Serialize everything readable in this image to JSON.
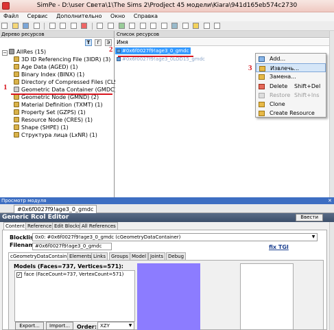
{
  "window": {
    "title": "SimPe - D:\\user Света\\1\\The Sims 2\\Prodject 45 модели\\Kiara\\941d165eb574c2730"
  },
  "menu": [
    "Файл",
    "Сервис",
    "Дополнительно",
    "Окно",
    "Справка"
  ],
  "tree": {
    "header": "Дерево ресурсов",
    "toolbar": [
      "T",
      "Г",
      "Э"
    ],
    "root": "AllRes (15)",
    "items": [
      "3D ID Referencing File (3IDR) (3)",
      "Age Data (AGED) (1)",
      "Binary Index (BINX) (1)",
      "Directory of Compressed Files (CLST) (1)",
      "Geometric Data Container (GMDC) (2)",
      "Geometric Node (GMND) (2)",
      "Material Definition (TXMT) (1)",
      "Property Set (GZPS) (1)",
      "Resource Node (CRES) (1)",
      "Shape (SHPE) (1)",
      "Структура лица (LxNR) (1)"
    ]
  },
  "list": {
    "header": "Список ресурсов",
    "column": "Имя",
    "rows": [
      "#0x6f0027f9!age3_0_gmdc",
      "#0x6f0027f9!age3_0LOD15_gmdc"
    ]
  },
  "context_menu": {
    "items": [
      {
        "label": "Add...",
        "shortcut": ""
      },
      {
        "label": "Извлечь...",
        "shortcut": ""
      },
      {
        "label": "Замена...",
        "shortcut": ""
      },
      {
        "label": "Delete",
        "shortcut": "Shift+Del"
      },
      {
        "label": "Restore",
        "shortcut": "Shift+Ins"
      },
      {
        "label": "Clone",
        "shortcut": ""
      },
      {
        "label": "Create Resource",
        "shortcut": ""
      }
    ]
  },
  "annotations": [
    "1",
    "2",
    "3"
  ],
  "preview": {
    "header": "Просмотр модуля",
    "tab": "#0x6f0027f9!age3_0_gmdc",
    "editor_title": "Generic Rcol Editor",
    "commit_button": "Ввести",
    "tabs": [
      "Content",
      "Reference",
      "Edit Blocks",
      "All References"
    ],
    "blocklist_label": "Blocklis",
    "blocklist_value": "0x0: #0x6f0027f9!age3_0_gmdc (cGeometryDataContainer)",
    "filename_label": "Filenam",
    "filename_value": "#0x6f0027f9!age3_0_gmdc",
    "fix_tgi": "fix TGI",
    "subtabs": [
      "cGeometryDataContainer",
      "Elements",
      "Links",
      "Groups",
      "Model",
      "Joints",
      "Debug"
    ],
    "models_label": "Models (Faces=737, Vertices=571):",
    "model_item": "face (FaceCount=737, VertexCount=571)",
    "export_button": "Export...",
    "import_button": "Import...",
    "order_label": "Order:",
    "order_value": "XZY",
    "preview_color": "#8c7cff"
  },
  "colors": {
    "annotation_red": "#d8141d",
    "selection_blue": "#3399ff"
  }
}
